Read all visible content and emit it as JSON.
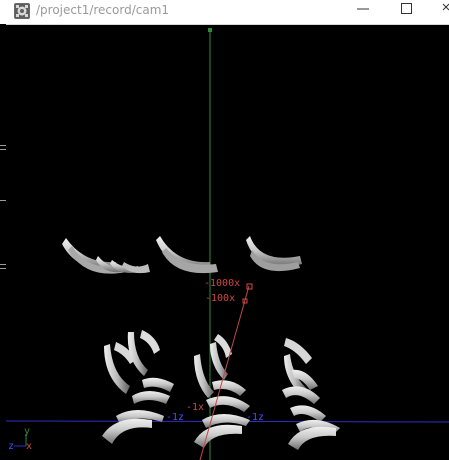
{
  "window": {
    "title": "/project1/record/cam1",
    "icon": "camera-node-icon",
    "controls": [
      "minimize-icon",
      "maximize-icon",
      "close-icon"
    ]
  },
  "viewport": {
    "labels": {
      "x1000": "-1000x",
      "x100": "-100x",
      "x1": "-1x",
      "z1_left": "-1z",
      "z1_right": "-1z"
    },
    "gizmo": {
      "y": "y",
      "z": "z",
      "x": "x"
    },
    "colors": {
      "background": "#000000",
      "y_axis": "#2f8a3a",
      "x_axis": "#c04848",
      "z_axis": "#2e2ec8",
      "geometry": "#d4d4d4"
    }
  }
}
